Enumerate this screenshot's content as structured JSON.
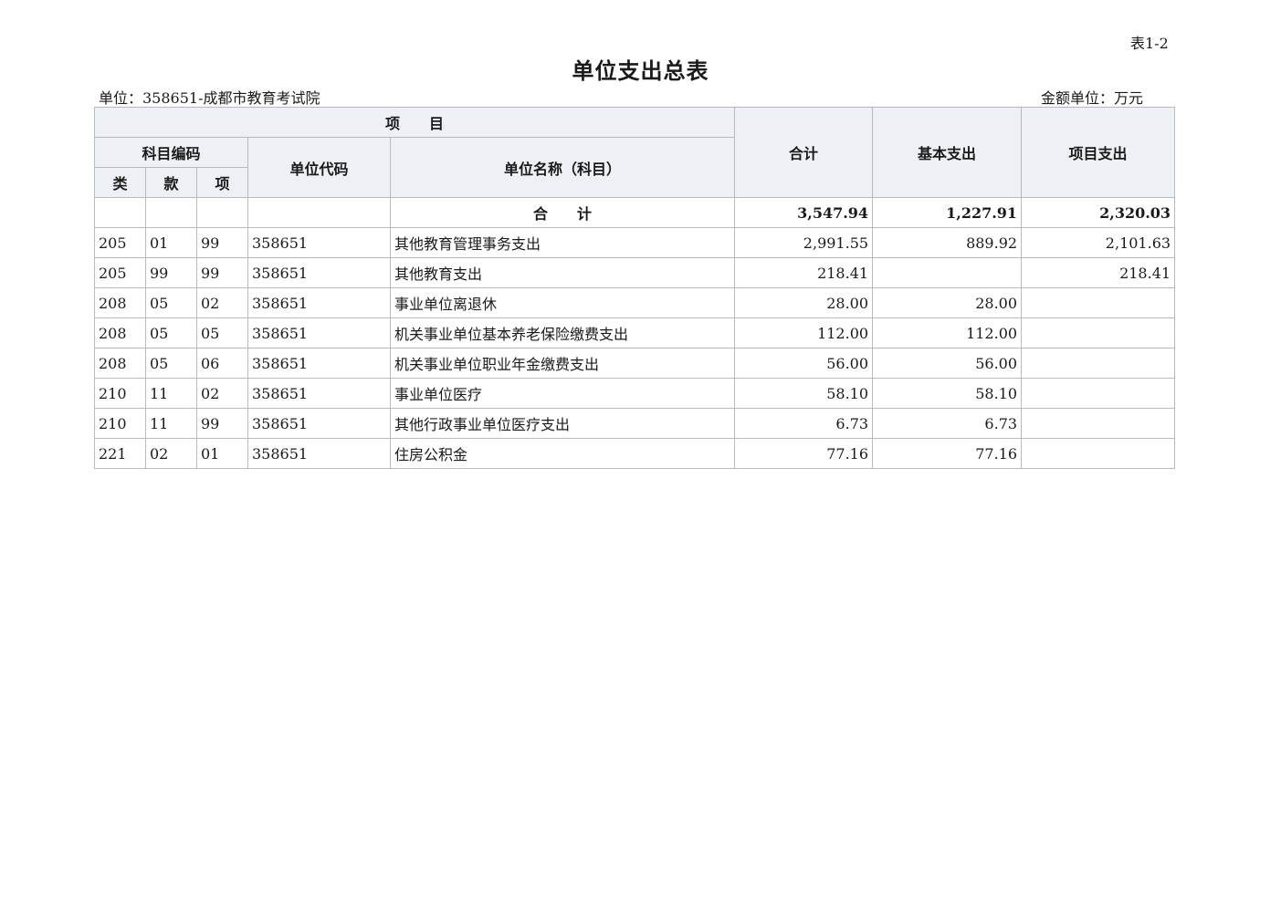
{
  "header": {
    "table_no": "表1-2",
    "title": "单位支出总表",
    "unit_info": "单位：358651-成都市教育考试院",
    "amount_unit": "金额单位：万元"
  },
  "columns": {
    "project": "项　　目",
    "subject_code": "科目编码",
    "lei": "类",
    "kuan": "款",
    "xiang": "项",
    "unit_code": "单位代码",
    "unit_name": "单位名称（科目）",
    "total": "合计",
    "basic": "基本支出",
    "project_exp": "项目支出"
  },
  "total_row": {
    "label": "合　　计",
    "total": "3,547.94",
    "basic": "1,227.91",
    "project": "2,320.03"
  },
  "rows": [
    {
      "lei": "205",
      "kuan": "01",
      "xiang": "99",
      "code": "358651",
      "name": "其他教育管理事务支出",
      "total": "2,991.55",
      "basic": "889.92",
      "project": "2,101.63"
    },
    {
      "lei": "205",
      "kuan": "99",
      "xiang": "99",
      "code": "358651",
      "name": "其他教育支出",
      "total": "218.41",
      "basic": "",
      "project": "218.41"
    },
    {
      "lei": "208",
      "kuan": "05",
      "xiang": "02",
      "code": "358651",
      "name": "事业单位离退休",
      "total": "28.00",
      "basic": "28.00",
      "project": ""
    },
    {
      "lei": "208",
      "kuan": "05",
      "xiang": "05",
      "code": "358651",
      "name": "机关事业单位基本养老保险缴费支出",
      "total": "112.00",
      "basic": "112.00",
      "project": ""
    },
    {
      "lei": "208",
      "kuan": "05",
      "xiang": "06",
      "code": "358651",
      "name": "机关事业单位职业年金缴费支出",
      "total": "56.00",
      "basic": "56.00",
      "project": ""
    },
    {
      "lei": "210",
      "kuan": "11",
      "xiang": "02",
      "code": "358651",
      "name": "事业单位医疗",
      "total": "58.10",
      "basic": "58.10",
      "project": ""
    },
    {
      "lei": "210",
      "kuan": "11",
      "xiang": "99",
      "code": "358651",
      "name": "其他行政事业单位医疗支出",
      "total": "6.73",
      "basic": "6.73",
      "project": ""
    },
    {
      "lei": "221",
      "kuan": "02",
      "xiang": "01",
      "code": "358651",
      "name": "住房公积金",
      "total": "77.16",
      "basic": "77.16",
      "project": ""
    }
  ]
}
